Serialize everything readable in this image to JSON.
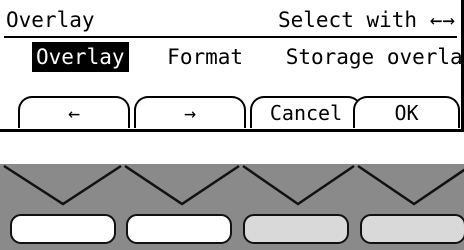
{
  "screen": {
    "title": "Overlay",
    "hint": "Select with ←→",
    "menu": [
      {
        "label": "Overlay",
        "selected": true
      },
      {
        "label": "Format",
        "selected": false
      },
      {
        "label": "Storage overlay",
        "selected": false
      }
    ],
    "softkeys": [
      {
        "label": "←",
        "icon": "arrow-left-icon"
      },
      {
        "label": "→",
        "icon": "arrow-right-icon"
      },
      {
        "label": "Cancel"
      },
      {
        "label": "OK"
      }
    ]
  },
  "panel": {
    "button_colors": [
      "#ffffff",
      "#ffffff",
      "#d9d9d9",
      "#d9d9d9"
    ],
    "background": "#8a8a8a"
  }
}
